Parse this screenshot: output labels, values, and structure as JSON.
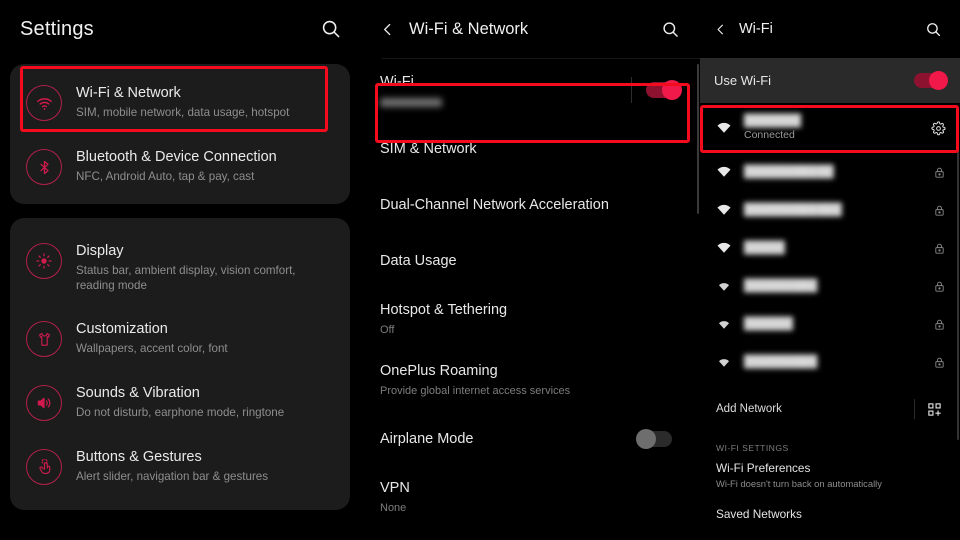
{
  "accent": {
    "red_annotation": "#f40b1d",
    "brand_crimson": "#b2204a",
    "toggle_on": "#e8133f",
    "panel_bg": "#000000",
    "card_bg": "#1c1c1c",
    "band_bg": "#2a2a2a"
  },
  "settings_panel": {
    "title": "Settings",
    "search_icon": "search-icon",
    "groups": [
      {
        "items": [
          {
            "icon": "wifi-icon",
            "title": "Wi-Fi & Network",
            "subtitle": "SIM, mobile network, data usage, hotspot",
            "highlighted": true
          },
          {
            "icon": "bluetooth-icon",
            "title": "Bluetooth & Device Connection",
            "subtitle": "NFC, Android Auto, tap & pay, cast",
            "highlighted": false
          }
        ]
      },
      {
        "items": [
          {
            "icon": "brightness-icon",
            "title": "Display",
            "subtitle": "Status bar, ambient display, vision comfort, reading mode",
            "highlighted": false
          },
          {
            "icon": "tshirt-icon",
            "title": "Customization",
            "subtitle": "Wallpapers, accent color, font",
            "highlighted": false
          },
          {
            "icon": "speaker-icon",
            "title": "Sounds & Vibration",
            "subtitle": "Do not disturb, earphone mode, ringtone",
            "highlighted": false
          },
          {
            "icon": "gesture-icon",
            "title": "Buttons & Gestures",
            "subtitle": "Alert slider, navigation bar & gestures",
            "highlighted": false
          }
        ]
      }
    ]
  },
  "network_panel": {
    "back_icon": "back-arrow-icon",
    "title": "Wi-Fi & Network",
    "search_icon": "search-icon",
    "rows": [
      {
        "title": "Wi-Fi",
        "subtitle": "",
        "subtitle_redacted": true,
        "toggle": "on",
        "highlighted": true
      },
      {
        "title": "SIM & Network",
        "subtitle": "",
        "toggle": null,
        "highlighted": false
      },
      {
        "title": "Dual-Channel Network Acceleration",
        "subtitle": "",
        "toggle": null,
        "highlighted": false
      },
      {
        "title": "Data Usage",
        "subtitle": "",
        "toggle": null,
        "highlighted": false
      },
      {
        "title": "Hotspot & Tethering",
        "subtitle": "Off",
        "toggle": null,
        "highlighted": false
      },
      {
        "title": "OnePlus Roaming",
        "subtitle": "Provide global internet access services",
        "toggle": null,
        "highlighted": false
      },
      {
        "title": "Airplane Mode",
        "subtitle": "",
        "toggle": "off",
        "highlighted": false
      },
      {
        "title": "VPN",
        "subtitle": "None",
        "toggle": null,
        "highlighted": false
      }
    ]
  },
  "wifi_panel": {
    "back_icon": "back-arrow-icon",
    "title": "Wi-Fi",
    "search_icon": "search-icon",
    "use_wifi_label": "Use Wi-Fi",
    "use_wifi_toggle": "on",
    "connected_network": {
      "name": "",
      "name_redacted": true,
      "status": "Connected",
      "gear_icon": "gear-icon",
      "highlighted": true
    },
    "available_networks": [
      {
        "name": "",
        "redacted": true,
        "signal": 4,
        "locked": true
      },
      {
        "name": "",
        "redacted": true,
        "signal": 4,
        "locked": true
      },
      {
        "name": "",
        "redacted": true,
        "signal": 4,
        "locked": true
      },
      {
        "name": "",
        "redacted": true,
        "signal": 3,
        "locked": true
      },
      {
        "name": "",
        "redacted": true,
        "signal": 3,
        "locked": true
      },
      {
        "name": "",
        "redacted": true,
        "signal": 3,
        "locked": true
      }
    ],
    "add_network_label": "Add Network",
    "add_network_icon": "qr-scan-icon",
    "settings_section_header": "WI-FI SETTINGS",
    "preferences": {
      "title": "Wi-Fi Preferences",
      "subtitle": "Wi-Fi doesn't turn back on automatically"
    },
    "saved_networks_label": "Saved Networks"
  }
}
